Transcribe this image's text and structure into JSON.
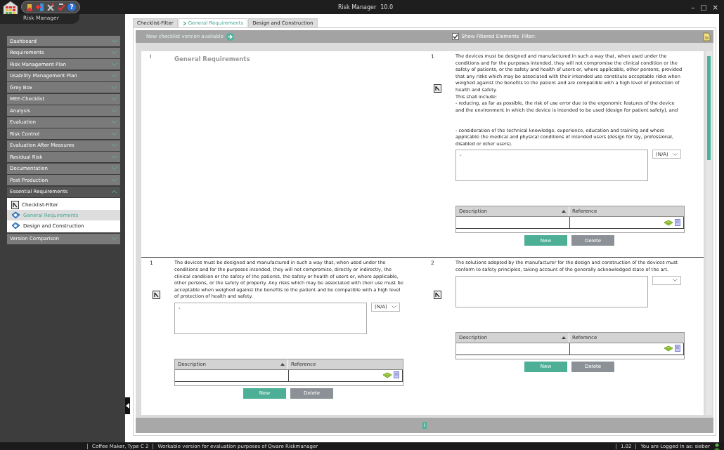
{
  "window": {
    "title": "Risk Manager",
    "version": "10.0",
    "help_glyph": "?",
    "controls": [
      "–",
      "□",
      "×"
    ]
  },
  "app_label": "Risk Manager",
  "sidebar": {
    "items": [
      {
        "label": "Dashboard",
        "expanded": false
      },
      {
        "label": "Requirements",
        "expanded": false
      },
      {
        "label": "Risk Management Plan",
        "expanded": false
      },
      {
        "label": "Usability Management Plan",
        "expanded": false
      },
      {
        "label": "Grey Box",
        "expanded": false
      },
      {
        "label": "MEE-Checklist",
        "expanded": false
      },
      {
        "label": "Analysis",
        "expanded": false
      },
      {
        "label": "Evaluation",
        "expanded": false
      },
      {
        "label": "Risk Control",
        "expanded": false
      },
      {
        "label": "Evaluation After Measures",
        "expanded": false
      },
      {
        "label": "Residual Risk",
        "expanded": false
      },
      {
        "label": "Documentation",
        "expanded": false
      },
      {
        "label": "Post Production",
        "expanded": false
      },
      {
        "label": "Essential Requirements",
        "expanded": true,
        "children": [
          {
            "label": "Checklist-Filter",
            "kind": "filter",
            "selected": false
          },
          {
            "label": "General Requirements",
            "kind": "requirement",
            "selected": true
          },
          {
            "label": "Design and Construction",
            "kind": "requirement",
            "selected": false
          }
        ]
      },
      {
        "label": "Version Comparison",
        "expanded": false
      }
    ]
  },
  "tabs": [
    {
      "label": "Checklist-Filter",
      "selected": false
    },
    {
      "label": "General Requirements",
      "selected": true
    },
    {
      "label": "Design and Construction",
      "selected": false
    }
  ],
  "toolbar": {
    "notice": "New checklist version available",
    "show_filtered": {
      "label": "Show Filtered Elements",
      "checked": true
    },
    "filter_label": "Filter:"
  },
  "rows": [
    [
      {
        "kind": "heading",
        "number": "I",
        "title": "General Requirements"
      },
      {
        "kind": "requirement",
        "number": "1",
        "text": "The devices must be designed and manufactured in such a way that, when used under the conditions and for the purposes intended, they will not compromise the clinical condition or the safety of patients, or the safety and health of users or, where applicable, other persons, provided that any risks which may be associated with their intended use constitute acceptable risks when weighed against the benefits to the patient and are compatible with a high level of protection of health and safety.\nThis shall include:\n-  reducing, as far as possible, the risk of use error due to the ergonomic features of the device and the environment in which the device is intended to be used (design for patient safety), and\n\n\n-  consideration of the technical knowledge, experience, education and training and where applicable the medical and physical conditions of intended users (design for lay, professional, disabled or other users).",
        "comment": "-",
        "rating": "(N/A)",
        "columns": [
          {
            "label": "Description",
            "sorted": true
          },
          {
            "label": "Reference",
            "sorted": false
          }
        ],
        "buttons": [
          "New",
          "Delete"
        ]
      }
    ],
    [
      {
        "kind": "requirement",
        "number": "1",
        "text": "The devices must be designed and manufactured in such a way that, when used under the conditions and for the purposes intended, they will not compromise, directly or indirectly, the clinical condition or the safety of the patients, the safety or health of users or, where applicable, other persons, or the safety of property. Any risks which may be associated with their use must be acceptable when weighed against the benefits to the patient and be compatible with a high level of protection of health and safety.",
        "comment": "-",
        "rating": "(N/A)",
        "columns": [
          {
            "label": "Description",
            "sorted": true
          },
          {
            "label": "Reference",
            "sorted": false
          }
        ],
        "buttons": [
          "New",
          "Delete"
        ]
      },
      {
        "kind": "requirement",
        "number": "2",
        "text": "The solutions adopted by the manufacturer for the design and construction of the devices must conform to safety principles, taking account of the generally acknowledged state of the art.",
        "columns": [
          {
            "label": "Description",
            "sorted": true
          },
          {
            "label": "Reference",
            "sorted": false
          }
        ],
        "buttons": [
          "New",
          "Delete"
        ]
      }
    ]
  ],
  "pager": [
    {
      "label": "I",
      "selected": true
    }
  ],
  "status_bar": [
    "Coffee Maker, Type C 2",
    "Workable version for evaluation purposes of Qware Riskmanager",
    "1.02",
    "You are Logged In as: sieber"
  ]
}
